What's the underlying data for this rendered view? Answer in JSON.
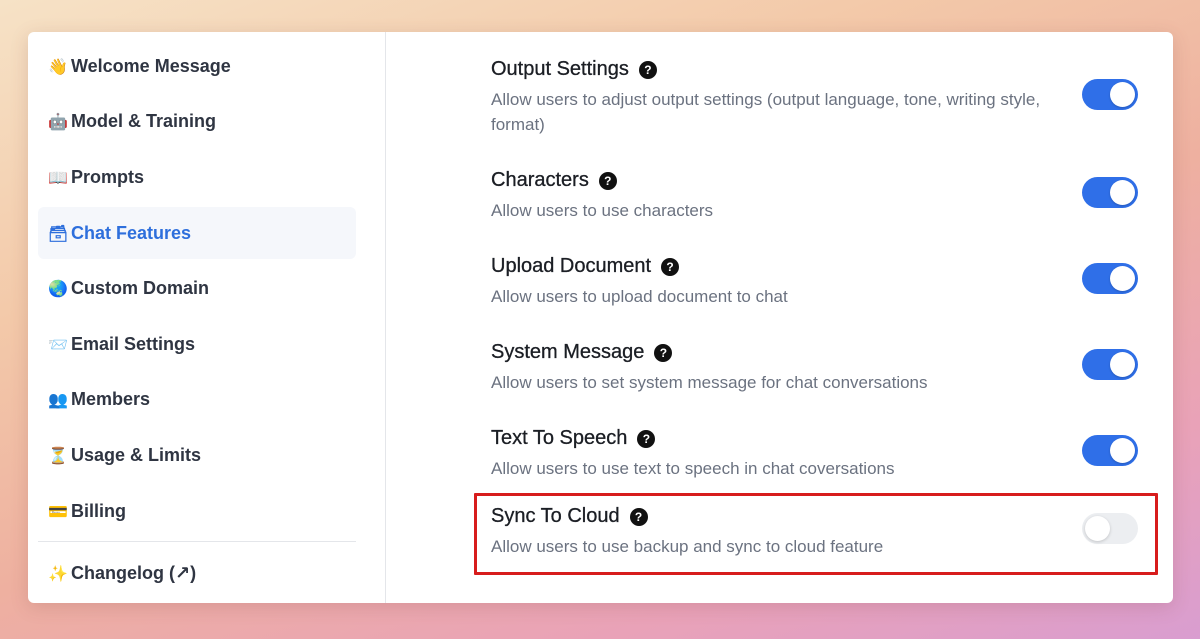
{
  "sidebar": {
    "items": [
      {
        "icon": "👋",
        "icon_name": "waving-hand-icon",
        "label": "Welcome Message"
      },
      {
        "icon": "🤖",
        "icon_name": "robot-icon",
        "label": "Model & Training"
      },
      {
        "icon": "📖",
        "icon_name": "book-icon",
        "label": "Prompts"
      },
      {
        "icon": "🗃",
        "icon_name": "card-box-icon",
        "label": "Chat Features",
        "active": true
      },
      {
        "icon": "🌏",
        "icon_name": "globe-icon",
        "label": "Custom Domain"
      },
      {
        "icon": "📨",
        "icon_name": "envelope-icon",
        "label": "Email Settings"
      },
      {
        "icon": "👥",
        "icon_name": "people-icon",
        "label": "Members"
      },
      {
        "icon": "⏳",
        "icon_name": "hourglass-icon",
        "label": "Usage & Limits"
      },
      {
        "icon": "💳",
        "icon_name": "credit-card-icon",
        "label": "Billing"
      },
      {
        "icon": "✨",
        "icon_name": "sparkles-icon",
        "label": "Changelog (↗)"
      }
    ]
  },
  "settings": [
    {
      "title": "Output Settings",
      "description": "Allow users to adjust output settings (output language, tone, writing style, format)",
      "enabled": true
    },
    {
      "title": "Characters",
      "description": "Allow users to use characters",
      "enabled": true
    },
    {
      "title": "Upload Document",
      "description": "Allow users to upload document to chat",
      "enabled": true
    },
    {
      "title": "System Message",
      "description": "Allow users to set system message for chat conversations",
      "enabled": true
    },
    {
      "title": "Text To Speech",
      "description": "Allow users to use text to speech in chat coversations",
      "enabled": true
    },
    {
      "title": "Sync To Cloud",
      "description": "Allow users to use backup and sync to cloud feature",
      "enabled": false
    }
  ],
  "help_glyph": "?",
  "colors": {
    "accent": "#2f6fe8",
    "active_nav_text": "#2e6fdc",
    "highlight_border": "#d71c1c",
    "toggle_off": "#eceef1"
  }
}
